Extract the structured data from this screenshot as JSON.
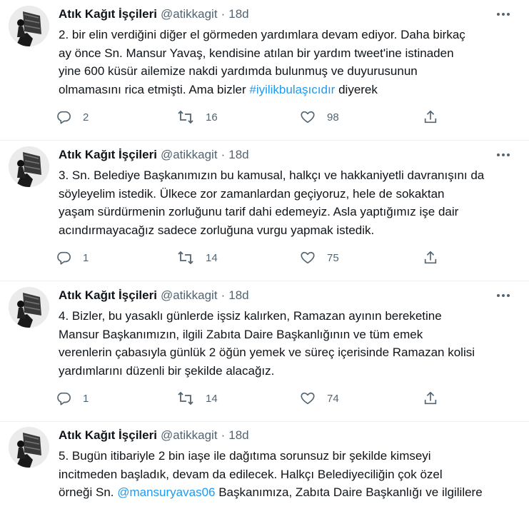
{
  "tweets": [
    {
      "author": "Atık Kağıt İşçileri",
      "handle": "@atikkagit",
      "separator": "·",
      "time": "18d",
      "lines": [
        [
          {
            "t": "2. bir elin verdiğini diğer el görmeden yardımlara devam ediyor. Daha birkaç"
          }
        ],
        [
          {
            "t": "ay önce Sn. Mansur Yavaş, kendisine atılan bir yardım tweet'ine istinaden"
          }
        ],
        [
          {
            "t": "yine 600 küsür ailemize nakdi yardımda bulunmuş ve duyurusunun"
          }
        ],
        [
          {
            "t": "olmamasını rica etmişti. Ama bizler "
          },
          {
            "t": "#iyilikbulaşıcıdır",
            "link": true
          },
          {
            "t": " diyerek"
          }
        ]
      ],
      "replies": "2",
      "retweets": "16",
      "likes": "98"
    },
    {
      "author": "Atık Kağıt İşçileri",
      "handle": "@atikkagit",
      "separator": "·",
      "time": "18d",
      "lines": [
        [
          {
            "t": "3. Sn. Belediye Başkanımızın bu kamusal, halkçı ve hakkaniyetli davranışını da"
          }
        ],
        [
          {
            "t": "söyleyelim istedik. Ülkece zor zamanlardan geçiyoruz, hele de sokaktan"
          }
        ],
        [
          {
            "t": "yaşam sürdürmenin zorluğunu tarif dahi edemeyiz. Asla yaptığımız işe dair"
          }
        ],
        [
          {
            "t": "acındırmayacağız sadece zorluğuna vurgu yapmak istedik."
          }
        ]
      ],
      "replies": "1",
      "retweets": "14",
      "likes": "75"
    },
    {
      "author": "Atık Kağıt İşçileri",
      "handle": "@atikkagit",
      "separator": "·",
      "time": "18d",
      "lines": [
        [
          {
            "t": "4. Bizler, bu yasaklı günlerde işsiz kalırken, Ramazan ayının bereketine"
          }
        ],
        [
          {
            "t": "Mansur Başkanımızın, ilgili Zabıta Daire Başkanlığının ve tüm emek"
          }
        ],
        [
          {
            "t": "verenlerin çabasıyla günlük 2 öğün yemek ve süreç içerisinde Ramazan kolisi"
          }
        ],
        [
          {
            "t": "yardımlarını düzenli bir şekilde alacağız."
          }
        ]
      ],
      "replies": "1",
      "retweets": "14",
      "likes": "74"
    },
    {
      "author": "Atık Kağıt İşçileri",
      "handle": "@atikkagit",
      "separator": "·",
      "time": "18d",
      "lines": [
        [
          {
            "t": "5. Bugün itibariyle 2 bin iaşe ile dağıtıma sorunsuz bir şekilde kimseyi"
          }
        ],
        [
          {
            "t": "incitmeden başladık, devam da edilecek. Halkçı Belediyeciliğin çok özel"
          }
        ],
        [
          {
            "t": "örneği Sn. "
          },
          {
            "t": "@mansuryavas06",
            "link": true
          },
          {
            "t": " Başkanımıza, Zabıta Daire Başkanlığı ve ilgililere"
          }
        ]
      ],
      "replies": "",
      "retweets": "",
      "likes": ""
    }
  ],
  "icons": {
    "more": "more-horizontal-icon",
    "reply": "reply-bubble-icon",
    "retweet": "retweet-arrows-icon",
    "like": "heart-icon",
    "share": "share-upload-icon"
  },
  "colors": {
    "text": "#0f1419",
    "secondary": "#536471",
    "link": "#1d9bf0",
    "divider": "#eff3f4"
  }
}
